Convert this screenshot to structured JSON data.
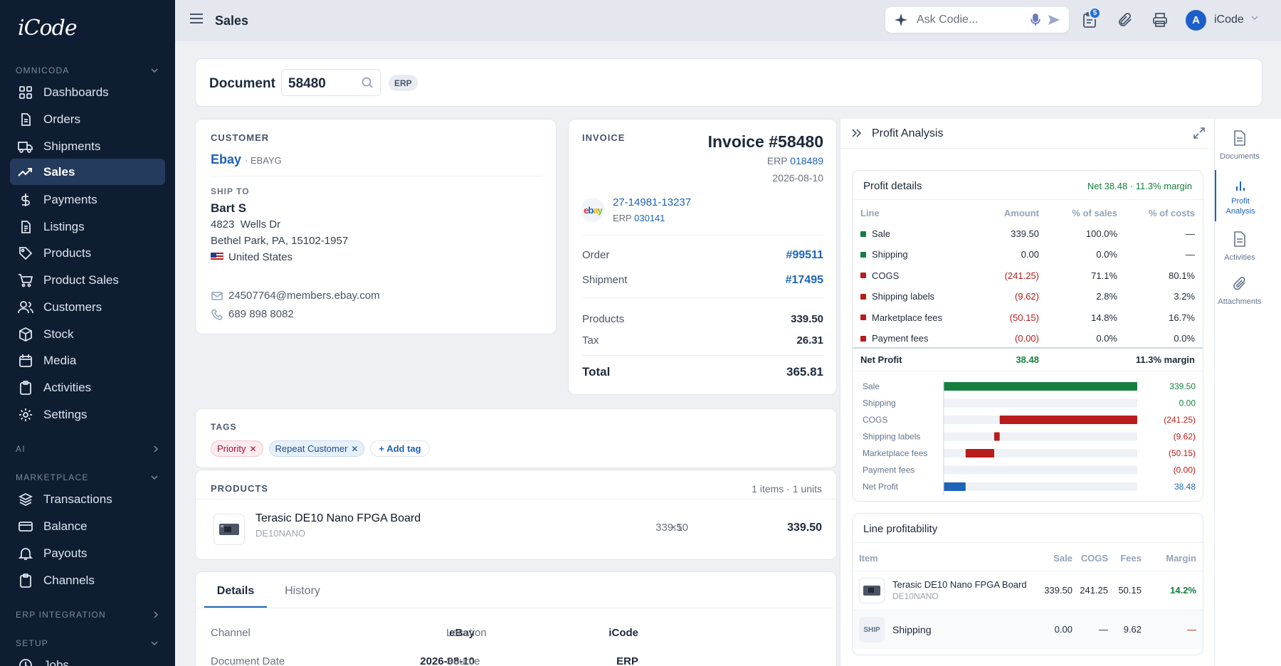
{
  "app": {
    "logo": "iCode"
  },
  "sidebar": {
    "sections": {
      "omnicoda": "OMNICODA",
      "ai": "AI",
      "marketplace": "MARKETPLACE",
      "erp": "ERP INTEGRATION",
      "setup": "SETUP"
    },
    "items": [
      {
        "label": "Dashboards",
        "icon": "grid-icon"
      },
      {
        "label": "Orders",
        "icon": "file-icon"
      },
      {
        "label": "Shipments",
        "icon": "truck-icon"
      },
      {
        "label": "Sales",
        "icon": "trending-up-icon"
      },
      {
        "label": "Payments",
        "icon": "dollar-icon"
      },
      {
        "label": "Listings",
        "icon": "list-icon"
      },
      {
        "label": "Products",
        "icon": "tag-icon"
      },
      {
        "label": "Product Sales",
        "icon": "cart-icon"
      },
      {
        "label": "Customers",
        "icon": "users-icon"
      },
      {
        "label": "Stock",
        "icon": "box-icon"
      },
      {
        "label": "Media",
        "icon": "calendar-icon"
      },
      {
        "label": "Activities",
        "icon": "clipboard-icon"
      },
      {
        "label": "Settings",
        "icon": "gear-icon"
      }
    ],
    "market_items": [
      {
        "label": "Transactions",
        "icon": "layers-icon"
      },
      {
        "label": "Balance",
        "icon": "card-icon"
      },
      {
        "label": "Payouts",
        "icon": "bell-icon"
      },
      {
        "label": "Channels",
        "icon": "clipboard-icon"
      }
    ],
    "setup_items": [
      {
        "label": "Jobs",
        "icon": "clock-icon"
      }
    ]
  },
  "topbar": {
    "title": "Sales",
    "ask_placeholder": "Ask Codie...",
    "notif_count": "5",
    "avatar_letter": "A",
    "user": "iCode"
  },
  "document": {
    "label": "Document",
    "number": "58480",
    "badge": "ERP"
  },
  "customer": {
    "label": "CUSTOMER",
    "name": "Ebay",
    "code": "· EBAYG",
    "ship_to_label": "SHIP TO",
    "ship_name": "Bart  S",
    "addr1": "4823  Wells Dr",
    "addr2": "Bethel Park, PA, 15102-1957",
    "country": "United States",
    "email": "24507764@members.ebay.com",
    "phone": "689 898 8082"
  },
  "invoice": {
    "label": "INVOICE",
    "title": "Invoice #58480",
    "erp_prefix": "ERP",
    "erp_num": "018489",
    "date": "2026-08-10",
    "marketplace_logo": "ebay",
    "order_ref": "27-14981-13237",
    "order_erp_prefix": "ERP",
    "order_erp": "030141",
    "order_label": "Order",
    "order_val": "#99511",
    "shipment_label": "Shipment",
    "shipment_val": "#17495",
    "products_label": "Products",
    "products_val": "339.50",
    "tax_label": "Tax",
    "tax_val": "26.31",
    "total_label": "Total",
    "total_val": "365.81"
  },
  "tags": {
    "label": "TAGS",
    "items": [
      "Priority",
      "Repeat Customer"
    ],
    "add": "+ Add tag"
  },
  "products": {
    "label": "PRODUCTS",
    "summary": "1 items · 1 units",
    "rows": [
      {
        "name": "Terasic DE10 Nano FPGA Board",
        "sku": "DE10NANO",
        "qty": "×1",
        "price": "339.50",
        "total": "339.50"
      }
    ]
  },
  "details": {
    "tabs": [
      "Details",
      "History"
    ],
    "fields": [
      {
        "k": "Channel",
        "v": "eBay"
      },
      {
        "k": "Location",
        "v": "iCode"
      },
      {
        "k": "Document Date",
        "v": "2026-08-10"
      },
      {
        "k": "Source",
        "v": "ERP"
      }
    ]
  },
  "profit": {
    "title": "Profit Analysis",
    "details_title": "Profit details",
    "net_summary": "Net 38.48 · 11.3% margin",
    "cols": [
      "Line",
      "Amount",
      "% of sales",
      "% of costs"
    ],
    "rows": [
      {
        "line": "Sale",
        "amount": "339.50",
        "ps": "100.0%",
        "pc": "—",
        "color": "#15803d"
      },
      {
        "line": "Shipping",
        "amount": "0.00",
        "ps": "0.0%",
        "pc": "—",
        "color": "#15803d"
      },
      {
        "line": "COGS",
        "amount": "(241.25)",
        "ps": "71.1%",
        "pc": "80.1%",
        "color": "#b91c1c"
      },
      {
        "line": "Shipping labels",
        "amount": "(9.62)",
        "ps": "2.8%",
        "pc": "3.2%",
        "color": "#b91c1c"
      },
      {
        "line": "Marketplace fees",
        "amount": "(50.15)",
        "ps": "14.8%",
        "pc": "16.7%",
        "color": "#b91c1c"
      },
      {
        "line": "Payment fees",
        "amount": "(0.00)",
        "ps": "0.0%",
        "pc": "0.0%",
        "color": "#b91c1c"
      }
    ],
    "net_label": "Net Profit",
    "net_val": "38.48",
    "net_margin": "11.3% margin"
  },
  "chart_data": {
    "type": "bar",
    "orientation": "horizontal",
    "waterfall": true,
    "categories": [
      "Sale",
      "Shipping",
      "COGS",
      "Shipping labels",
      "Marketplace fees",
      "Payment fees",
      "Net Profit"
    ],
    "values": [
      339.5,
      0.0,
      -241.25,
      -9.62,
      -50.15,
      0.0,
      38.48
    ],
    "labels": [
      "339.50",
      "0.00",
      "(241.25)",
      "(9.62)",
      "(50.15)",
      "(0.00)",
      "38.48"
    ],
    "colors": [
      "#15803d",
      "#15803d",
      "#b91c1c",
      "#b91c1c",
      "#b91c1c",
      "#b91c1c",
      "#1d63b8"
    ],
    "xlim": [
      0,
      339.5
    ]
  },
  "line_profit": {
    "title": "Line profitability",
    "cols": [
      "Item",
      "Sale",
      "COGS",
      "Fees",
      "Margin"
    ],
    "rows": [
      {
        "name": "Terasic DE10 Nano FPGA Board",
        "sku": "DE10NANO",
        "sale": "339.50",
        "cogs": "241.25",
        "fees": "50.15",
        "margin": "14.2%"
      },
      {
        "thumb": "SHIP",
        "name": "Shipping",
        "sale": "0.00",
        "cogs": "—",
        "fees": "9.62",
        "margin": "—"
      }
    ]
  },
  "rail": [
    {
      "label": "Documents"
    },
    {
      "label": "Profit Analysis"
    },
    {
      "label": "Activities"
    },
    {
      "label": "Attachments"
    }
  ]
}
